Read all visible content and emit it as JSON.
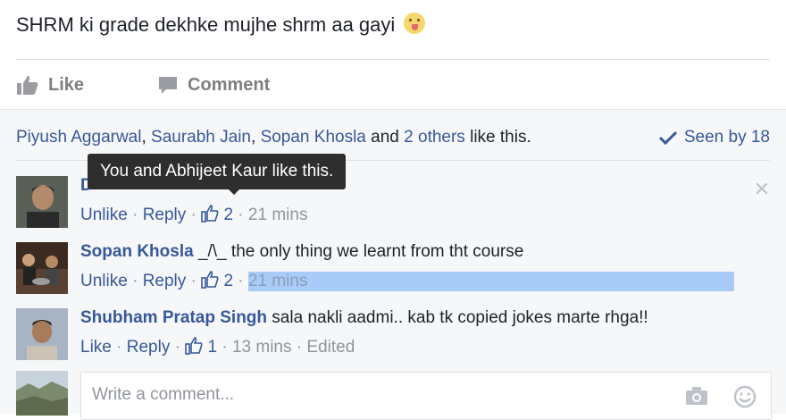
{
  "post": {
    "text": "SHRM ki grade dekhke mujhe shrm aa gayi",
    "emoji_icon": "tongue-out-emoji"
  },
  "actions": {
    "like_label": "Like",
    "comment_label": "Comment"
  },
  "likes_summary": {
    "names": [
      "Piyush Aggarwal",
      "Saurabh Jain",
      "Sopan Khosla"
    ],
    "sep1": ", ",
    "sep2": ", ",
    "and_text": " and ",
    "others": "2 others",
    "suffix": " like this.",
    "seen_by": "Seen by 18"
  },
  "tooltip": "You and Abhijeet Kaur like this.",
  "comments": [
    {
      "author": "D",
      "text": "",
      "action1": "Unlike",
      "action2": "Reply",
      "likes": "2",
      "time": "21 mins",
      "edited": ""
    },
    {
      "author": "Sopan Khosla",
      "text": " _/\\_ the only thing we learnt from tht course",
      "action1": "Unlike",
      "action2": "Reply",
      "likes": "2",
      "time": "21 mins",
      "edited": ""
    },
    {
      "author": "Shubham Pratap Singh",
      "text": " sala nakli aadmi.. kab tk copied jokes marte rhga!!",
      "action1": "Like",
      "action2": "Reply",
      "likes": "1",
      "time": "13 mins",
      "edited": "Edited"
    }
  ],
  "composer": {
    "placeholder": "Write a comment..."
  },
  "colors": {
    "link": "#365899",
    "muted": "#90949c",
    "highlight": "#a9cbf7",
    "panel_bg": "#f6f7f9"
  }
}
